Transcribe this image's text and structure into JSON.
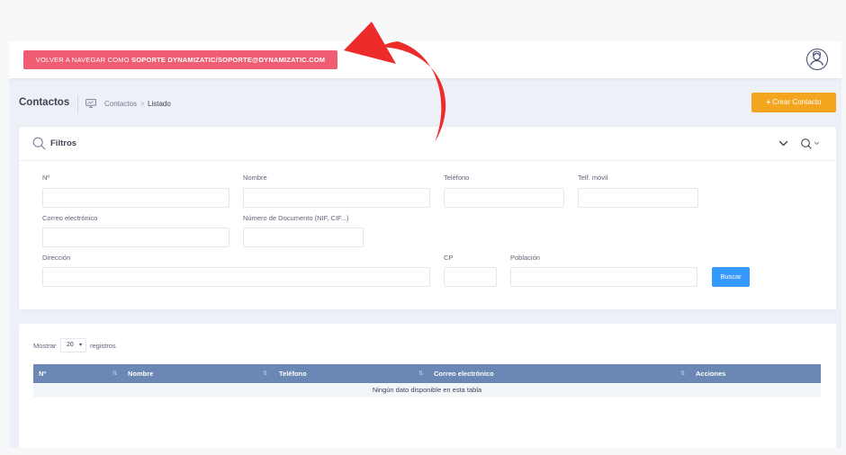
{
  "topbar": {
    "return_prefix": "VOLVER A NAVEGAR COMO",
    "return_user": "SOPORTE DYNAMIZATIC/SOPORTE@DYNAMIZATIC.COM"
  },
  "subheader": {
    "title": "Contactos",
    "breadcrumb": [
      "Contactos",
      "Listado"
    ],
    "breadcrumb_separator": ">",
    "create_button": "Crear Contacto"
  },
  "filters": {
    "title": "Filtros",
    "fields": {
      "numero": {
        "label": "Nº",
        "value": ""
      },
      "nombre": {
        "label": "Nombre",
        "value": ""
      },
      "telefono": {
        "label": "Teléfono",
        "value": ""
      },
      "movil": {
        "label": "Telf. móvil",
        "value": ""
      },
      "email": {
        "label": "Correo electrónico",
        "value": ""
      },
      "documento": {
        "label": "Número de Documento (NIF, CIF...)",
        "value": ""
      },
      "direccion": {
        "label": "Dirección",
        "value": ""
      },
      "cp": {
        "label": "CP",
        "value": ""
      },
      "poblacion": {
        "label": "Población",
        "value": ""
      }
    },
    "search_button": "Buscar"
  },
  "table": {
    "length_prefix": "Mostrar",
    "length_value": "20",
    "length_suffix": "registros",
    "columns": [
      "Nº",
      "Nombre",
      "Teléfono",
      "Correo electrónico",
      "Acciones"
    ],
    "empty_message": "Ningún dato disponible en esta tabla"
  },
  "colors": {
    "return_button": "#ef5d72",
    "create_button": "#f3a51f",
    "search_button": "#3699ff",
    "table_header": "#6b87b3",
    "annotation_arrow": "#ee2b2b"
  },
  "icons": {
    "avatar": "user-avatar-icon",
    "breadcrumb": "monitor-icon",
    "filters": "search-icon",
    "collapse": "chevron-down-icon",
    "search_toggle": "search-dropdown-icon",
    "sort": "sort-arrows-icon",
    "create": "plus-icon"
  }
}
